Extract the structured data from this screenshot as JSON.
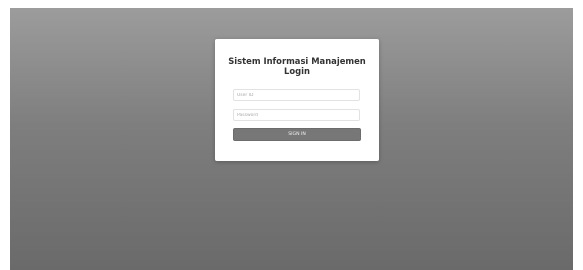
{
  "login": {
    "title": "Sistem Informasi Manajemen\nLogin",
    "user_id_placeholder": "User ID",
    "password_placeholder": "Password",
    "sign_in_label": "SIGN IN"
  }
}
